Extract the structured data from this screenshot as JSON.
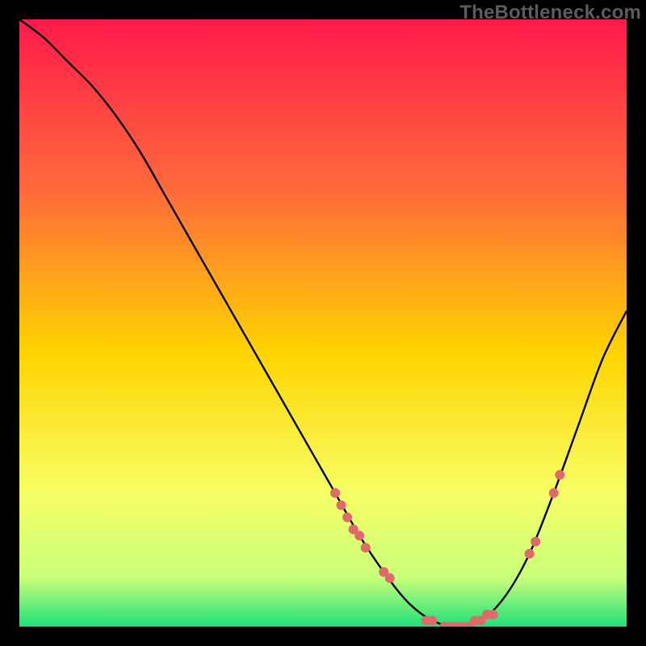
{
  "watermark": "TheBottleneck.com",
  "chart_data": {
    "type": "line",
    "title": "",
    "xlabel": "",
    "ylabel": "",
    "xlim": [
      0,
      100
    ],
    "ylim": [
      0,
      100
    ],
    "grid": false,
    "legend": false,
    "gradient_stops": [
      {
        "offset": 0,
        "color": "#ff1a4b"
      },
      {
        "offset": 28,
        "color": "#ff6a3a"
      },
      {
        "offset": 55,
        "color": "#ffd400"
      },
      {
        "offset": 78,
        "color": "#f7ff66"
      },
      {
        "offset": 92,
        "color": "#c8ff7a"
      },
      {
        "offset": 100,
        "color": "#1fe07a"
      }
    ],
    "series": [
      {
        "name": "bottleneck-curve",
        "x": [
          0,
          4,
          8,
          12,
          16,
          20,
          24,
          28,
          32,
          36,
          40,
          44,
          48,
          52,
          56,
          60,
          64,
          68,
          72,
          76,
          80,
          84,
          88,
          92,
          96,
          100
        ],
        "y": [
          100,
          97,
          93,
          89,
          84,
          78,
          71,
          64,
          57,
          50,
          43,
          36,
          29,
          22,
          15,
          9,
          4,
          1,
          0,
          1,
          5,
          12,
          22,
          33,
          44,
          52
        ]
      }
    ],
    "markers": {
      "name": "highlighted-points",
      "color": "#e06a6a",
      "radius": 6,
      "points": [
        {
          "x": 52,
          "y": 22
        },
        {
          "x": 53,
          "y": 20
        },
        {
          "x": 54,
          "y": 18
        },
        {
          "x": 55,
          "y": 16
        },
        {
          "x": 56,
          "y": 15
        },
        {
          "x": 57,
          "y": 13
        },
        {
          "x": 60,
          "y": 9
        },
        {
          "x": 61,
          "y": 8
        },
        {
          "x": 67,
          "y": 1
        },
        {
          "x": 68,
          "y": 1
        },
        {
          "x": 70,
          "y": 0
        },
        {
          "x": 71,
          "y": 0
        },
        {
          "x": 72,
          "y": 0
        },
        {
          "x": 73,
          "y": 0
        },
        {
          "x": 74,
          "y": 0
        },
        {
          "x": 75,
          "y": 1
        },
        {
          "x": 76,
          "y": 1
        },
        {
          "x": 77,
          "y": 2
        },
        {
          "x": 78,
          "y": 2
        },
        {
          "x": 84,
          "y": 12
        },
        {
          "x": 85,
          "y": 14
        },
        {
          "x": 88,
          "y": 22
        },
        {
          "x": 89,
          "y": 25
        }
      ]
    }
  }
}
